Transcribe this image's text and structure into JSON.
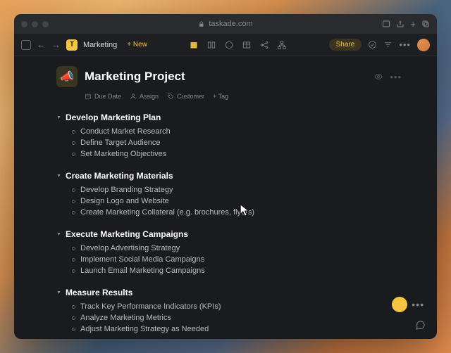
{
  "browser": {
    "url": "taskade.com"
  },
  "app": {
    "breadcrumb": "Marketing",
    "new_label": "+ New",
    "share_label": "Share",
    "logo_letter": "T"
  },
  "project": {
    "icon": "📣",
    "title": "Marketing Project",
    "meta": {
      "due_date": "Due Date",
      "assign": "Assign",
      "customer_tag": "Customer",
      "add_tag": "+ Tag"
    },
    "placeholder": ""
  },
  "sections": [
    {
      "title": "Develop Marketing Plan",
      "items": [
        "Conduct Market Research",
        "Define Target Audience",
        "Set Marketing Objectives"
      ]
    },
    {
      "title": "Create Marketing Materials",
      "items": [
        "Develop Branding Strategy",
        "Design Logo and Website",
        "Create Marketing Collateral (e.g. brochures, flyers)"
      ]
    },
    {
      "title": "Execute Marketing Campaigns",
      "items": [
        "Develop Advertising Strategy",
        "Implement Social Media Campaigns",
        "Launch Email Marketing Campaigns"
      ]
    },
    {
      "title": "Measure Results",
      "items": [
        "Track Key Performance Indicators (KPIs)",
        "Analyze Marketing Metrics",
        "Adjust Marketing Strategy as Needed"
      ]
    }
  ]
}
